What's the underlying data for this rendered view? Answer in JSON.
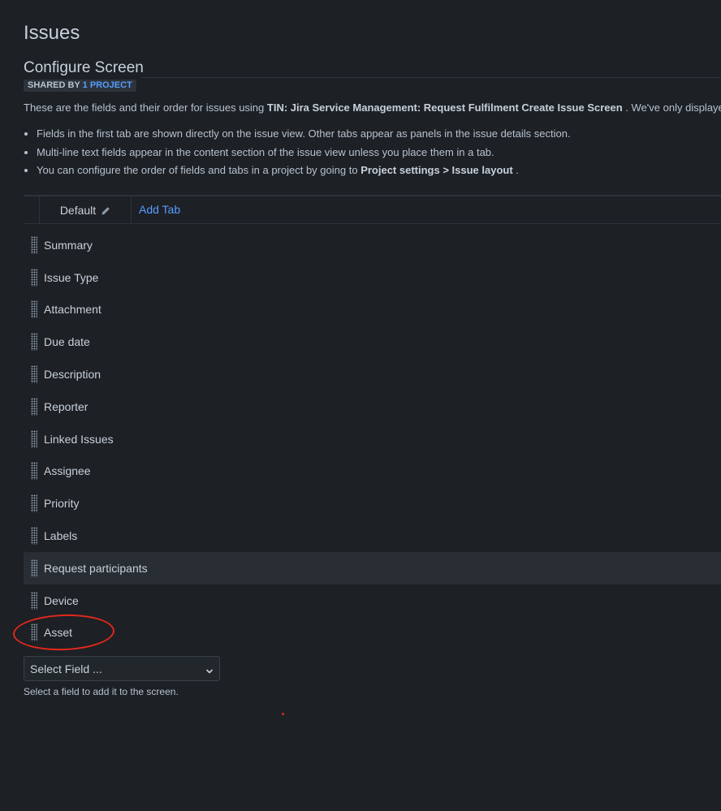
{
  "page": {
    "title": "Issues"
  },
  "screen": {
    "title": "Configure Screen",
    "shared_prefix": "SHARED BY ",
    "shared_link": "1 PROJECT",
    "intro_prefix": "These are the fields and their order for issues using ",
    "intro_screen_name": "TIN: Jira Service Management: Request Fulfilment Create Issue Screen",
    "intro_suffix": " . We've only displayed",
    "notes": [
      {
        "text": "Fields in the first tab are shown directly on the issue view. Other tabs appear as panels in the issue details section."
      },
      {
        "text": "Multi-line text fields appear in the content section of the issue view unless you place them in a tab."
      },
      {
        "text_prefix": "You can configure the order of fields and tabs in a project by going to ",
        "bold": "Project settings > Issue layout",
        "text_suffix": " ."
      }
    ]
  },
  "tabs": {
    "default_label": "Default",
    "edit_icon": "pencil-icon",
    "add_tab_label": "Add Tab"
  },
  "fields": [
    {
      "label": "Summary"
    },
    {
      "label": "Issue Type"
    },
    {
      "label": "Attachment"
    },
    {
      "label": "Due date"
    },
    {
      "label": "Description"
    },
    {
      "label": "Reporter"
    },
    {
      "label": "Linked Issues"
    },
    {
      "label": "Assignee"
    },
    {
      "label": "Priority"
    },
    {
      "label": "Labels"
    },
    {
      "label": "Request participants",
      "highlighted": true
    },
    {
      "label": "Device"
    },
    {
      "label": "Asset",
      "circled": true
    }
  ],
  "add_field": {
    "select_value": "Select Field ...",
    "helper_text": "Select a field to add it to the screen."
  },
  "colors": {
    "background": "#1d2025",
    "link": "#579dff",
    "annotation": "#e3281b",
    "row_highlight": "#282e33"
  }
}
